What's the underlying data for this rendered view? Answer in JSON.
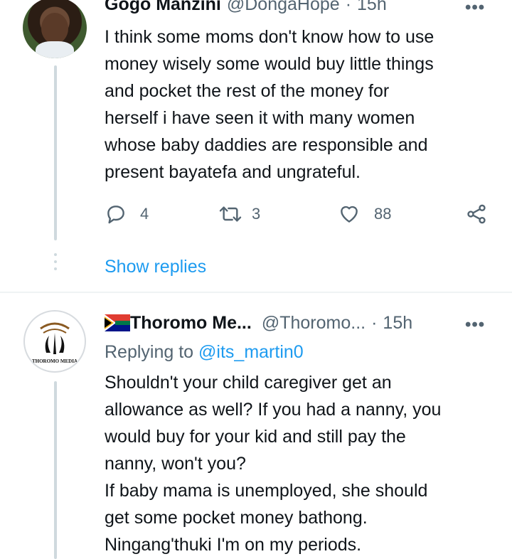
{
  "tweet1": {
    "display_name": "Gogo Manzini",
    "handle": "@DongaHope",
    "separator": "·",
    "time": "15h",
    "text_lines": [
      "I think some moms don't know how to use",
      "money wisely some would buy little things",
      "and pocket the rest of the money for",
      "herself i have seen it with many women",
      "whose baby daddies are responsible and",
      "present bayatefa and ungrateful."
    ],
    "actions": {
      "replies": "4",
      "retweets": "3",
      "likes": "88"
    },
    "show_replies": "Show replies"
  },
  "tweet2": {
    "display_name": "Thoromo Me...",
    "handle": "@Thoromo...",
    "separator": "·",
    "time": "15h",
    "flag_icon": "south-africa-flag-icon",
    "avatar_logo_text": "THOROMO MEDIA",
    "replying_to_label": "Replying to",
    "replying_to_handle": "@its_martin0",
    "text_lines": [
      "Shouldn't your child caregiver get an",
      "allowance as well? If you had a nanny, you",
      "would buy for your kid and still pay the",
      "nanny, won't you?",
      "If baby mama is unemployed, she should",
      "get some pocket money bathong.",
      "Ningang'thuki I'm on my periods."
    ]
  },
  "colors": {
    "accent": "#1d9bf0",
    "secondary_text": "#536471",
    "divider": "#eff3f4"
  }
}
